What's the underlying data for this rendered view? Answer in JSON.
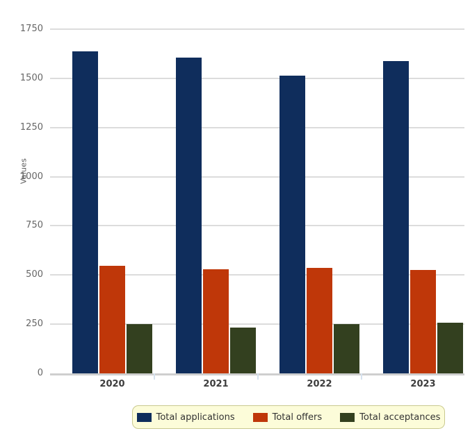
{
  "chart_data": {
    "type": "bar",
    "title": "",
    "subtitle": "",
    "xlabel": "",
    "ylabel": "Values",
    "categories": [
      "2020",
      "2021",
      "2022",
      "2023"
    ],
    "series": [
      {
        "name": "Total applications",
        "color": "#0f2d5c",
        "values": [
          1637,
          1605,
          1512,
          1588
        ]
      },
      {
        "name": "Total offers",
        "color": "#bf3709",
        "values": [
          547,
          529,
          537,
          524
        ]
      },
      {
        "name": "Total acceptances",
        "color": "#33401f",
        "values": [
          251,
          233,
          250,
          259
        ]
      }
    ],
    "ylim": [
      0,
      1750
    ],
    "yticks": [
      0,
      250,
      500,
      750,
      1000,
      1250,
      1500,
      1750
    ],
    "ytick_labels": [
      "0",
      "250",
      "500",
      "750",
      "1000",
      "1250",
      "1500",
      "1750"
    ],
    "grid": true,
    "legend_position": "bottom",
    "bar_group_gap": true,
    "background": "#ffffff",
    "gridline_color": "#dcdcdc",
    "axis_color": "#cfcfcf",
    "legend_background": "#fcfcd9",
    "legend_border": "#c9c98e",
    "tick_label_color": "#666666",
    "category_label_color": "#3d3d3d"
  }
}
